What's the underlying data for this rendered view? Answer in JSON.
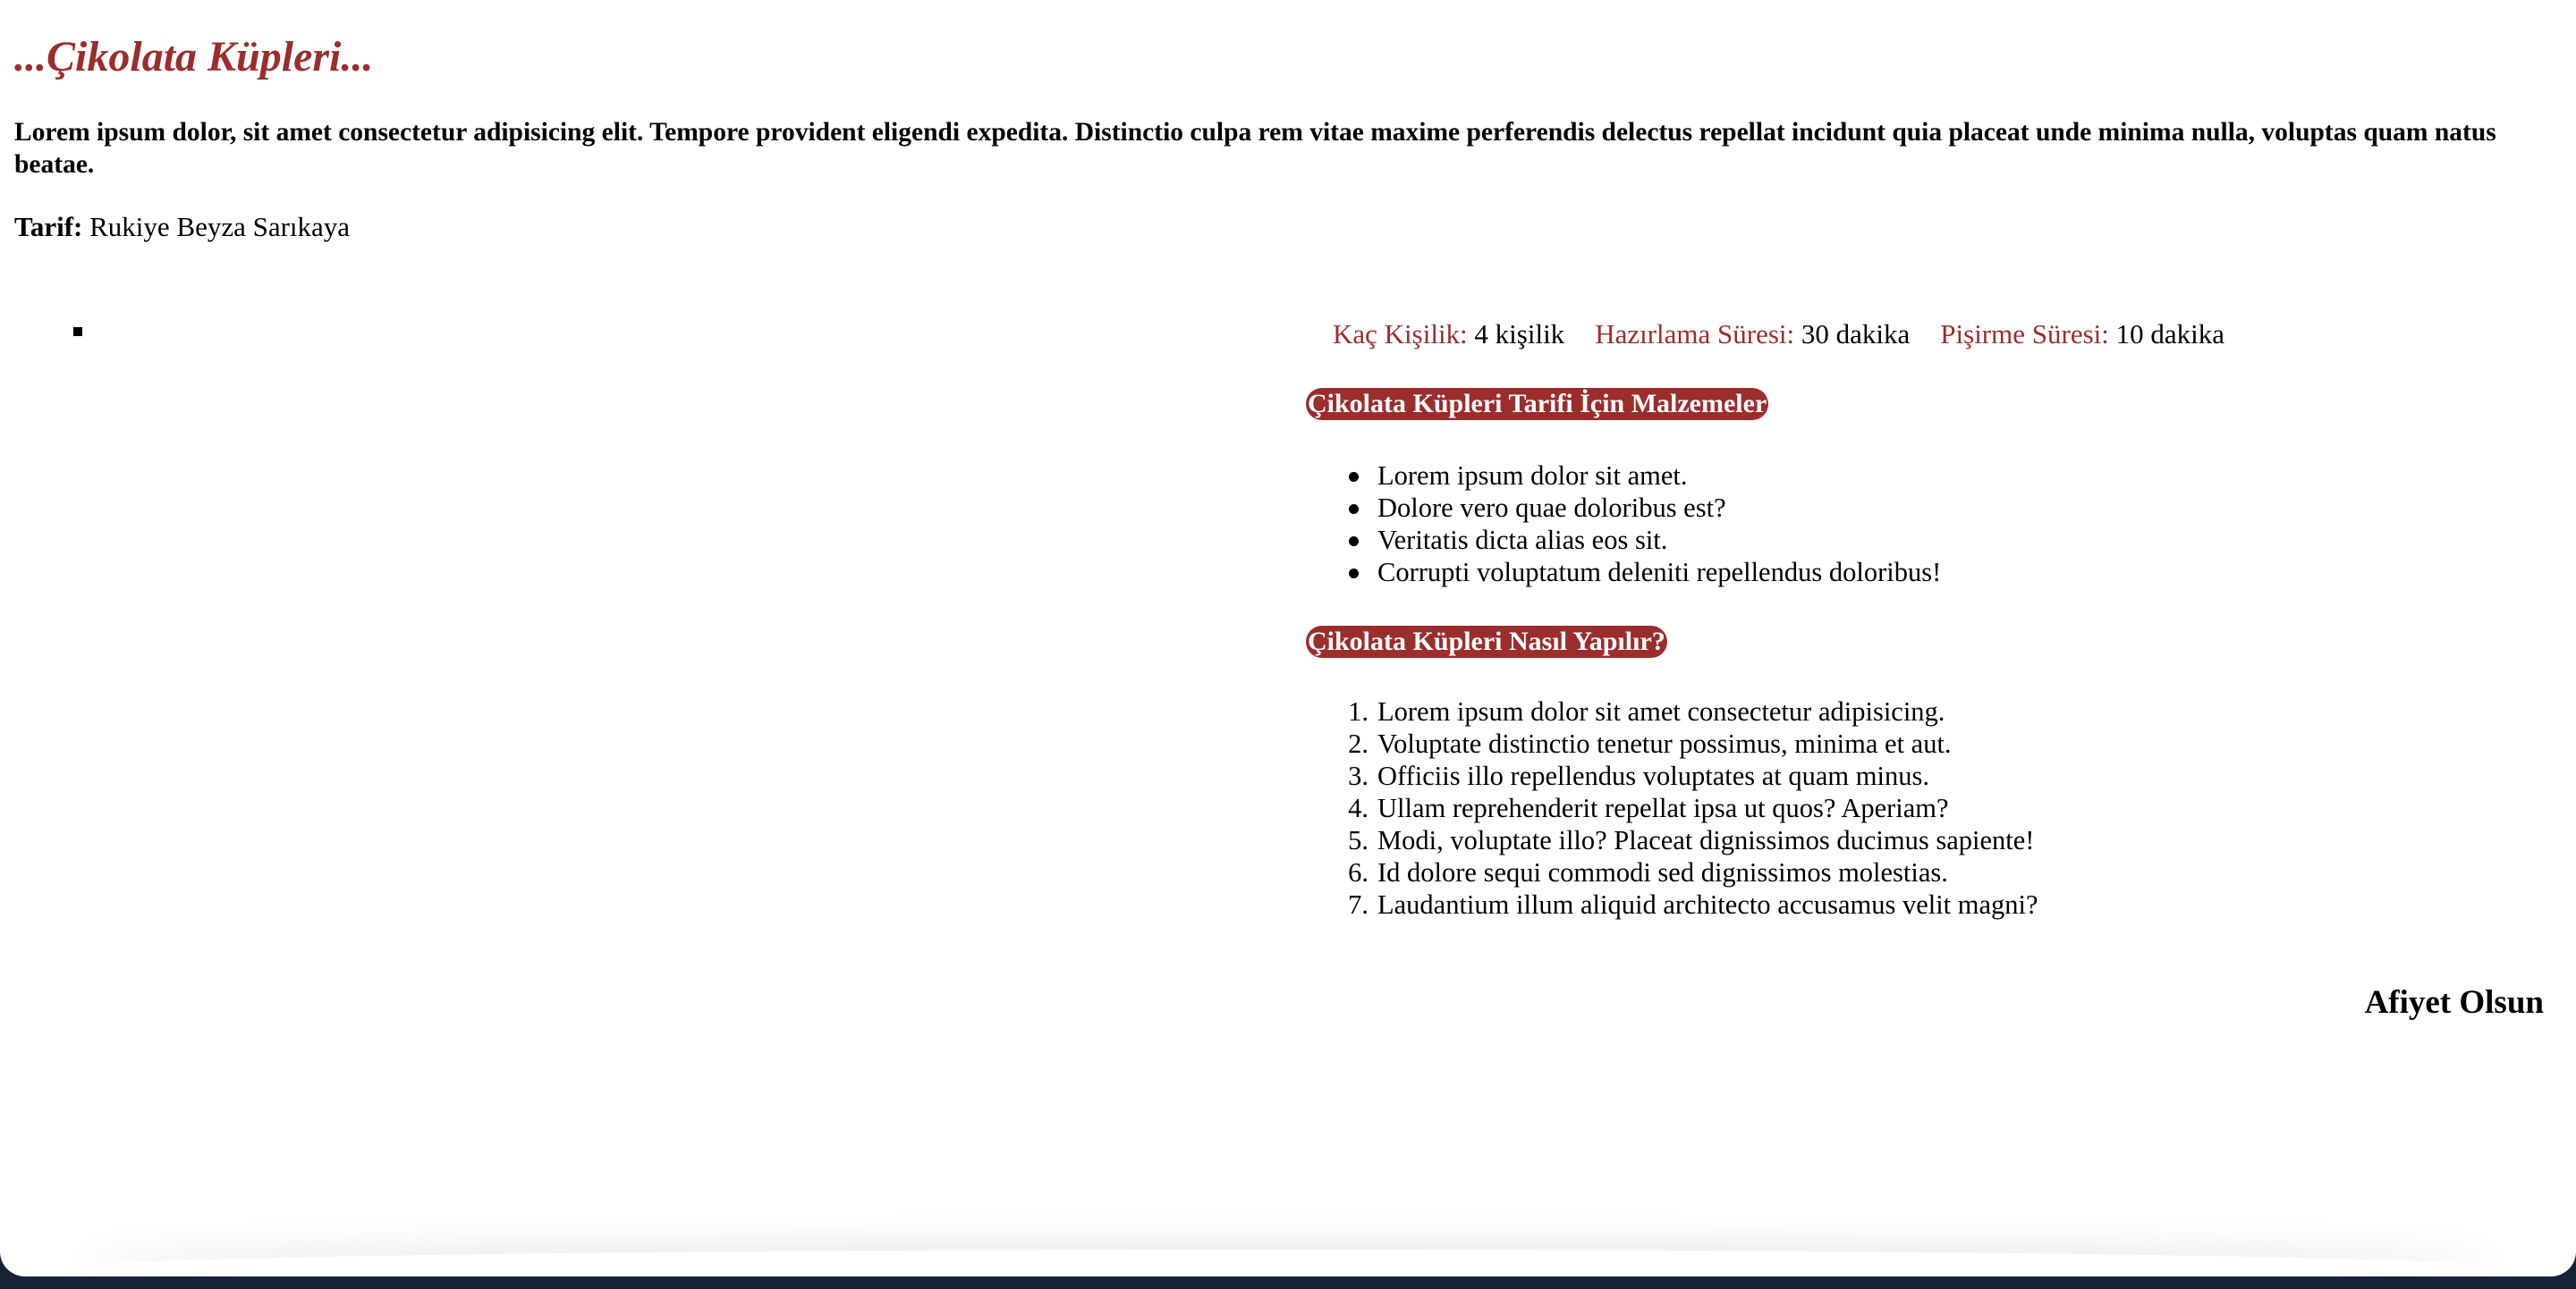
{
  "recipe": {
    "title": "...Çikolata Küpleri...",
    "intro": "Lorem ipsum dolor, sit amet consectetur adipisicing elit. Tempore provident eligendi expedita. Distinctio culpa rem vitae maxime perferendis delectus repellat incidunt quia placeat unde minima nulla, voluptas quam natus beatae.",
    "author_label": "Tarif:",
    "author_name": "Rukiye Beyza Sarıkaya"
  },
  "info": [
    {
      "label": "Kaç Kişilik:",
      "value": "4 kişilik"
    },
    {
      "label": "Hazırlama Süresi:",
      "value": "30 dakika"
    },
    {
      "label": "Pişirme Süresi:",
      "value": "10 dakika"
    }
  ],
  "ingredients": {
    "heading": "Çikolata Küpleri Tarifi İçin Malzemeler",
    "items": [
      "Lorem ipsum dolor sit amet.",
      "Dolore vero quae doloribus est?",
      "Veritatis dicta alias eos sit.",
      "Corrupti voluptatum deleniti repellendus doloribus!"
    ]
  },
  "steps": {
    "heading": "Çikolata Küpleri Nasıl Yapılır?",
    "items": [
      {
        "num": "1.",
        "text": "Lorem ipsum dolor sit amet consectetur adipisicing."
      },
      {
        "num": "2.",
        "text": "Voluptate distinctio tenetur possimus, minima et aut."
      },
      {
        "num": "3.",
        "text": "Officiis illo repellendus voluptates at quam minus."
      },
      {
        "num": "4.",
        "text": "Ullam reprehenderit repellat ipsa ut quos? Aperiam?"
      },
      {
        "num": "5.",
        "text": "Modi, voluptate illo? Placeat dignissimos ducimus sapiente!"
      },
      {
        "num": "6.",
        "text": "Id dolore sequi commodi sed dignissimos molestias."
      },
      {
        "num": "7.",
        "text": "Laudantium illum aliquid architecto accusamus velit magni?"
      }
    ]
  },
  "closing": "Afiyet Olsun",
  "colors": {
    "accent": "#9b2d2d",
    "text": "#000000",
    "background": "#ffffff"
  }
}
